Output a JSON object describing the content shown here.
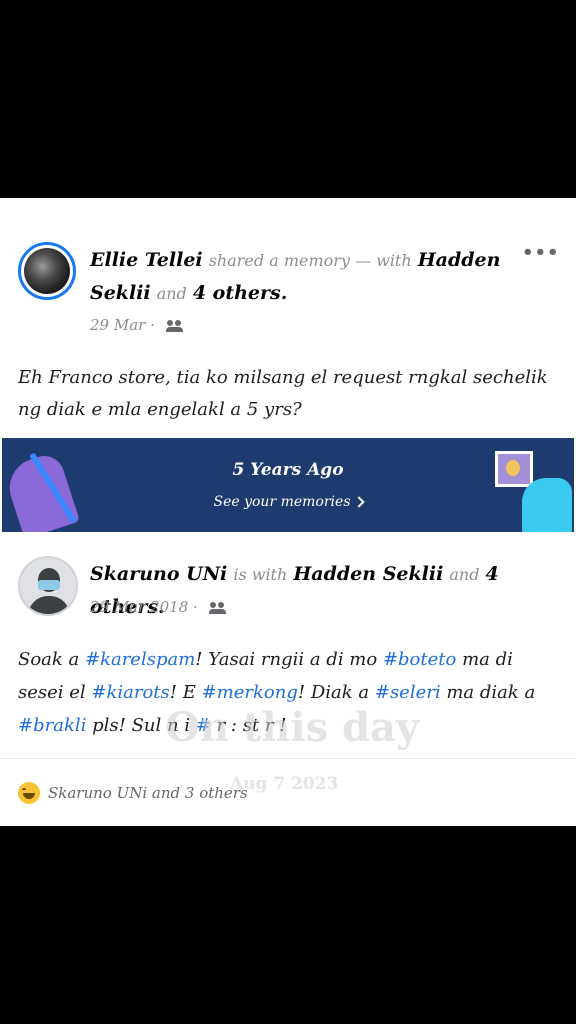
{
  "post1": {
    "author": "Ellie Tellei",
    "action": "shared a memory — with",
    "tagged": "Hadden Seklii",
    "and_word": "and",
    "others": "4 others.",
    "date": "29 Mar ·",
    "text": "Eh Franco store, tia ko milsang el request rngkal sechelik ng diak e mla engelakl a 5 yrs?",
    "more_icon": "•••"
  },
  "banner": {
    "title": "5 Years Ago",
    "link": "See your memories"
  },
  "post2": {
    "author": "Skaruno UNi",
    "action": "is with",
    "tagged": "Hadden Seklii",
    "and_word": "and",
    "others": "4 others.",
    "date": "29 Mar 2018 ·",
    "text_parts": {
      "p1": "Soak a ",
      "t1": "#karelspam",
      "p2": "! Yasai rngii a di mo ",
      "t2": "#boteto",
      "p3": " ma di sesei el ",
      "t3": "#kiarots",
      "p4": "! E ",
      "t4": "#merkong",
      "p5": "! Diak a ",
      "t5": "#seleri",
      "p6": " ma diak a ",
      "t6": "#brakli",
      "p7": " pls! Sul  n   i  ",
      "t7": "#",
      "p8": "  r  :  st  r !"
    }
  },
  "watermark": {
    "title": "On this day",
    "date": "Aug 7 2023"
  },
  "reactions": {
    "emoji": "laughing-emoji",
    "text": "Skaruno UNi and 3 others"
  }
}
